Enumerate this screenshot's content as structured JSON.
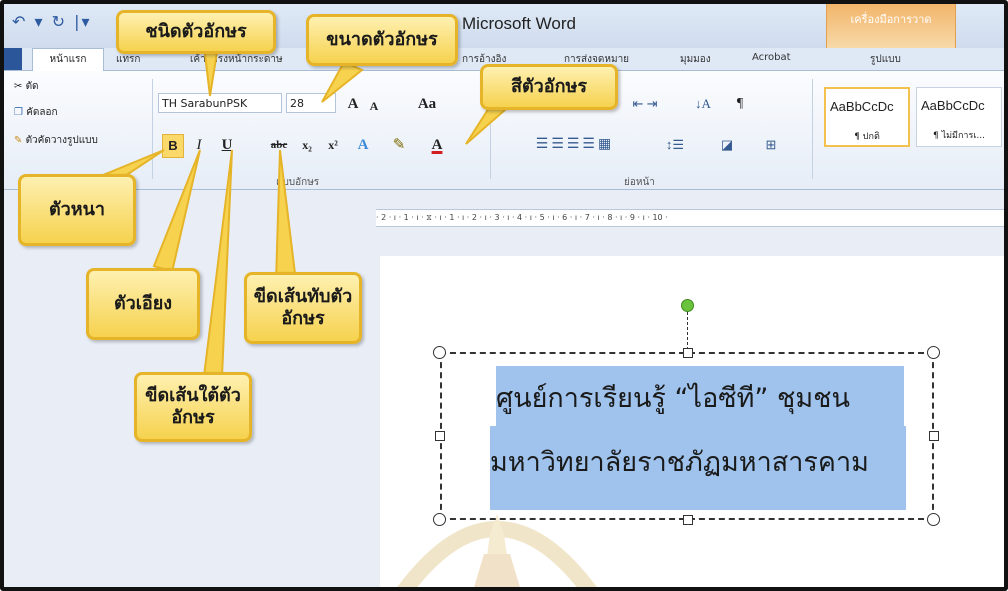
{
  "app": {
    "title": "Microsoft Word",
    "contextual_tab_group": "เครื่องมือการวาด",
    "quick_access": "↶ ▾ ↻ |▾"
  },
  "tabs": [
    "หน้าแรก",
    "แทรก",
    "เค้าโครงหน้ากระดาษ",
    "การอ้างอิง",
    "การส่งจดหมาย",
    "มุมมอง",
    "Acrobat",
    "รูปแบบ"
  ],
  "clipboard": {
    "cut": "ตัด",
    "copy": "คัดลอก",
    "format_painter": "ตัวคัดวางรูปแบบ"
  },
  "font": {
    "name": "TH SarabunPSK",
    "size": "28",
    "grow": "A",
    "shrink": "A",
    "case": "Aa",
    "group_label": "แบบอักษร",
    "bold": "B",
    "italic": "I",
    "underline": "U",
    "strikethrough": "abc",
    "subscript": "x₂",
    "superscript": "x²",
    "color_a": "A"
  },
  "paragraph": {
    "group_label": "ย่อหน้า"
  },
  "styles": [
    {
      "preview": "AaBbCcDc",
      "name": "¶ ปกติ"
    },
    {
      "preview": "AaBbCcDc",
      "name": "¶ ไม่มีการเ..."
    }
  ],
  "ruler": "· 2 · ı · 1 · ı ·  ⧖ · ı · 1 · ı · 2 · ı · 3 · ı · 4 · ı · 5 · ı · 6 · ı · 7 · ı · 8 · ı · 9 · ı · 10 ·",
  "document": {
    "line1": "ศูนย์การเรียนรู้ “ไอซีที” ชุมชน",
    "line2": "มหาวิทยาลัยราชภัฏมหาสารคาม"
  },
  "callouts": {
    "font_type": "ชนิดตัวอักษร",
    "font_size": "ขนาดตัวอักษร",
    "font_color": "สีตัวอักษร",
    "bold": "ตัวหนา",
    "italic": "ตัวเอียง",
    "strikethrough": "ขีดเส้นทับตัวอักษร",
    "underline": "ขีดเส้นใต้ตัวอักษร"
  },
  "colors": {
    "callout_fill": "#f6d24e",
    "callout_border": "#e6b428",
    "highlight": "#9fc3ec",
    "contextual_tab": "#f2b56a",
    "rotate_handle": "#6ac23d"
  }
}
